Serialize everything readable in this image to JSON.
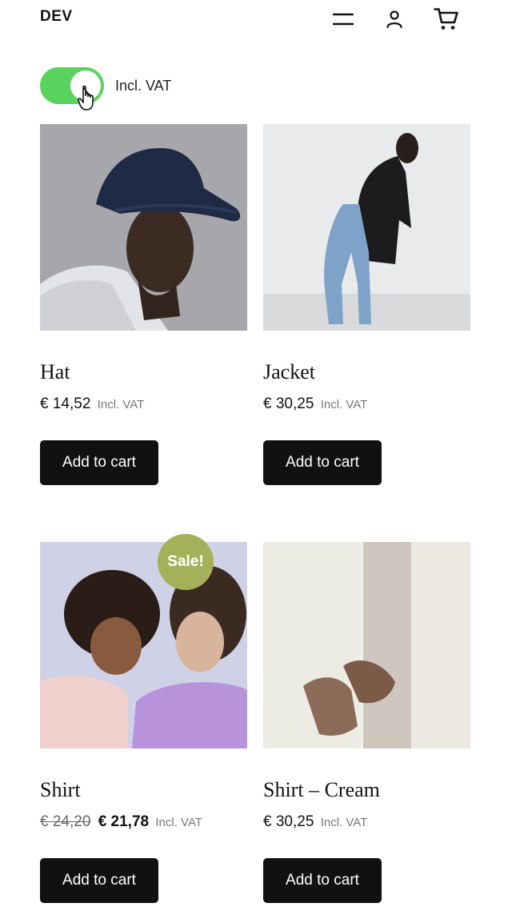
{
  "header": {
    "logo": "DEV",
    "icons": [
      "menu-icon",
      "user-icon",
      "cart-icon"
    ]
  },
  "vat_toggle": {
    "label": "Incl. VAT",
    "on": true,
    "color": "#5ad35e"
  },
  "products": [
    {
      "name": "Hat",
      "price": "€ 14,52",
      "vat_note": "Incl. VAT",
      "button": "Add to cart"
    },
    {
      "name": "Jacket",
      "price": "€ 30,25",
      "vat_note": "Incl. VAT",
      "button": "Add to cart"
    },
    {
      "name": "Shirt",
      "old_price": "€ 24,20",
      "price": "€ 21,78",
      "vat_note": "Incl. VAT",
      "button": "Add to cart",
      "badge": "Sale!"
    },
    {
      "name": "Shirt – Cream",
      "price": "€ 30,25",
      "vat_note": "Incl. VAT",
      "button": "Add to cart"
    }
  ],
  "colors": {
    "accent_toggle": "#5ad35e",
    "sale_badge": "#a5b15a",
    "button_bg": "#111111"
  }
}
